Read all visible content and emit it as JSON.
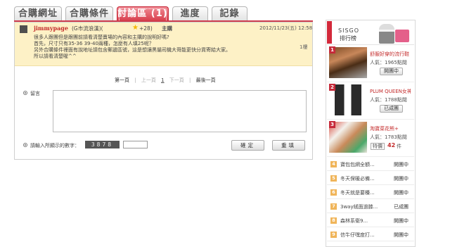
{
  "tabs": [
    {
      "label": "合購網址"
    },
    {
      "label": "合購條件"
    },
    {
      "label": "討論區 (1)"
    },
    {
      "label": "進度"
    },
    {
      "label": "記錄"
    }
  ],
  "post": {
    "username": "jimmypage",
    "location": "(G市流浪漢)(",
    "score": "+28)",
    "role": "主購",
    "timestamp": "2012/11/23(五) 12:58",
    "floor": "1樓",
    "body": [
      "很多人跟團但是跟團前請看清楚賣場的內容和主購的說明好嗎?",
      "首先，尺寸只有35-36 39-40兩種，怎麼有人填25呢？",
      "另外合購條件裡面有說地址請包含郵遞區號，這是想讓黑貓司機大哥能更快分貨寄給大家。",
      "所以請看清楚喔^^"
    ]
  },
  "pager": {
    "first": "第一頁",
    "prev": "上一頁",
    "current": "1",
    "next": "下一頁",
    "last": "最後一頁"
  },
  "form": {
    "message_label": "留言",
    "code_label": "請輸入所顯示的數字：",
    "captcha": "3878",
    "confirm_label": "確定",
    "rewrite_label": "重填"
  },
  "sidebar": {
    "brand": "SISGO",
    "title": "排行榜",
    "top": [
      {
        "rank": "1",
        "title": "舒服好穿的流行鞋",
        "popularity": "人氣：1965點閱",
        "status": "開團中"
      },
      {
        "rank": "2",
        "title": "PLUM QUEEN女神",
        "popularity": "人氣：1788點閱",
        "status": "已成團"
      },
      {
        "rank": "3",
        "title": "淘寶菜花熊+",
        "popularity": "人氣：1783點閱",
        "price_label": "特價",
        "price": "42",
        "price_unit": "件"
      }
    ],
    "list": [
      {
        "num": "4",
        "title": "寶包包網全額...",
        "status": "開團中"
      },
      {
        "num": "5",
        "title": "冬天保暖必備...",
        "status": "開團中"
      },
      {
        "num": "6",
        "title": "冬天就是要檯...",
        "status": "開團中"
      },
      {
        "num": "7",
        "title": "3way絨面過膝...",
        "status": "已成團"
      },
      {
        "num": "8",
        "title": "森林系衛9...",
        "status": "開團中"
      },
      {
        "num": "9",
        "title": "信牛仔嘿度打...",
        "status": "開團中"
      }
    ]
  },
  "colors": {
    "accent": "#d3293b",
    "post_background": "#fdf1c6",
    "rank_number": "#f0b55a"
  }
}
